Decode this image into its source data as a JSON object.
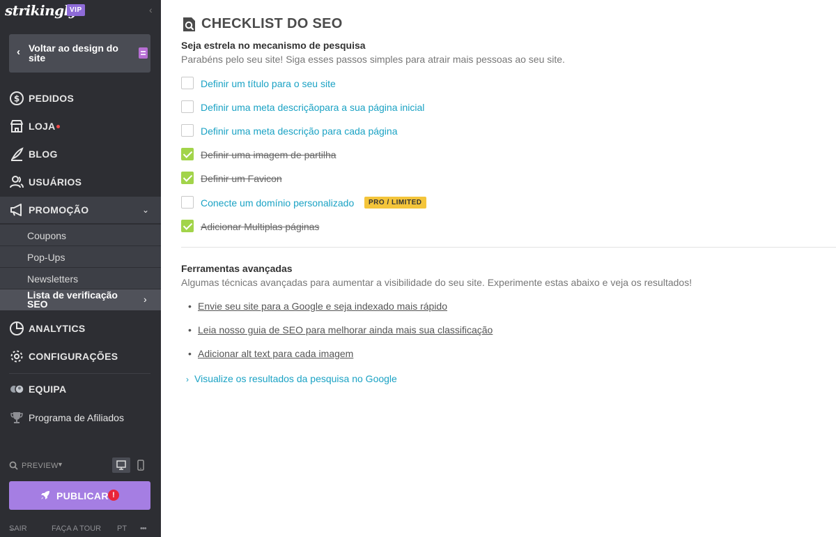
{
  "sidebar": {
    "logo": "strikingly",
    "vip_badge": "VIP",
    "back_button": "Voltar ao design do site",
    "nav": {
      "pedidos": "PEDIDOS",
      "loja": "LOJA",
      "blog": "BLOG",
      "usuarios": "USUÁRIOS",
      "promocao": "PROMOÇÃO",
      "analytics": "ANALYTICS",
      "configuracoes": "CONFIGURAÇÕES",
      "equipa": "EQUIPA",
      "afiliados": "Programa de Afiliados"
    },
    "promo_sub": {
      "coupons": "Coupons",
      "popups": "Pop-Ups",
      "newsletters": "Newsletters",
      "seo": "Lista de verificação SEO"
    },
    "preview": "PREVIEW",
    "publish": "PUBLICAR",
    "publish_alert": "!",
    "footer": {
      "sair": "SAIR",
      "tour": "FAÇA A TOUR",
      "lang": "PT",
      "more": "•••"
    }
  },
  "main": {
    "title": "CHECKLIST DO SEO",
    "heading": "Seja estrela no mecanismo de pesquisa",
    "description": "Parabéns pelo seu site! Siga esses passos simples para atrair mais pessoas ao seu site.",
    "checklist": [
      {
        "label": "Definir um título para o seu site",
        "checked": false
      },
      {
        "label": "Definir uma meta descriçãopara a sua página inicial",
        "checked": false
      },
      {
        "label": "Definir uma meta descrição para cada página",
        "checked": false
      },
      {
        "label": "Definir uma imagem de partilha",
        "checked": true
      },
      {
        "label": "Definir um Favicon",
        "checked": true
      },
      {
        "label": "Conecte um domínio personalizado",
        "checked": false,
        "badge": "PRO / LIMITED"
      },
      {
        "label": "Adicionar Multiplas páginas",
        "checked": true
      }
    ],
    "advanced_heading": "Ferramentas avançadas",
    "advanced_description": "Algumas técnicas avançadas para aumentar a visibilidade do seu site. Experimente estas abaixo e veja os resultados!",
    "advanced_links": [
      "Envie seu site para a Google e seja indexado mais rápido",
      "Leia nosso guia de SEO para melhorar ainda mais sua classificação",
      "Adicionar alt text para cada imagem"
    ],
    "search_preview_toggle": "Visualize os resultados da pesquisa no Google"
  },
  "colors": {
    "sidebar_bg": "#2d2e33",
    "accent_purple": "#a57ee3",
    "link": "#1aa2c4",
    "check": "#a2d44a",
    "badge": "#f4c53b"
  }
}
